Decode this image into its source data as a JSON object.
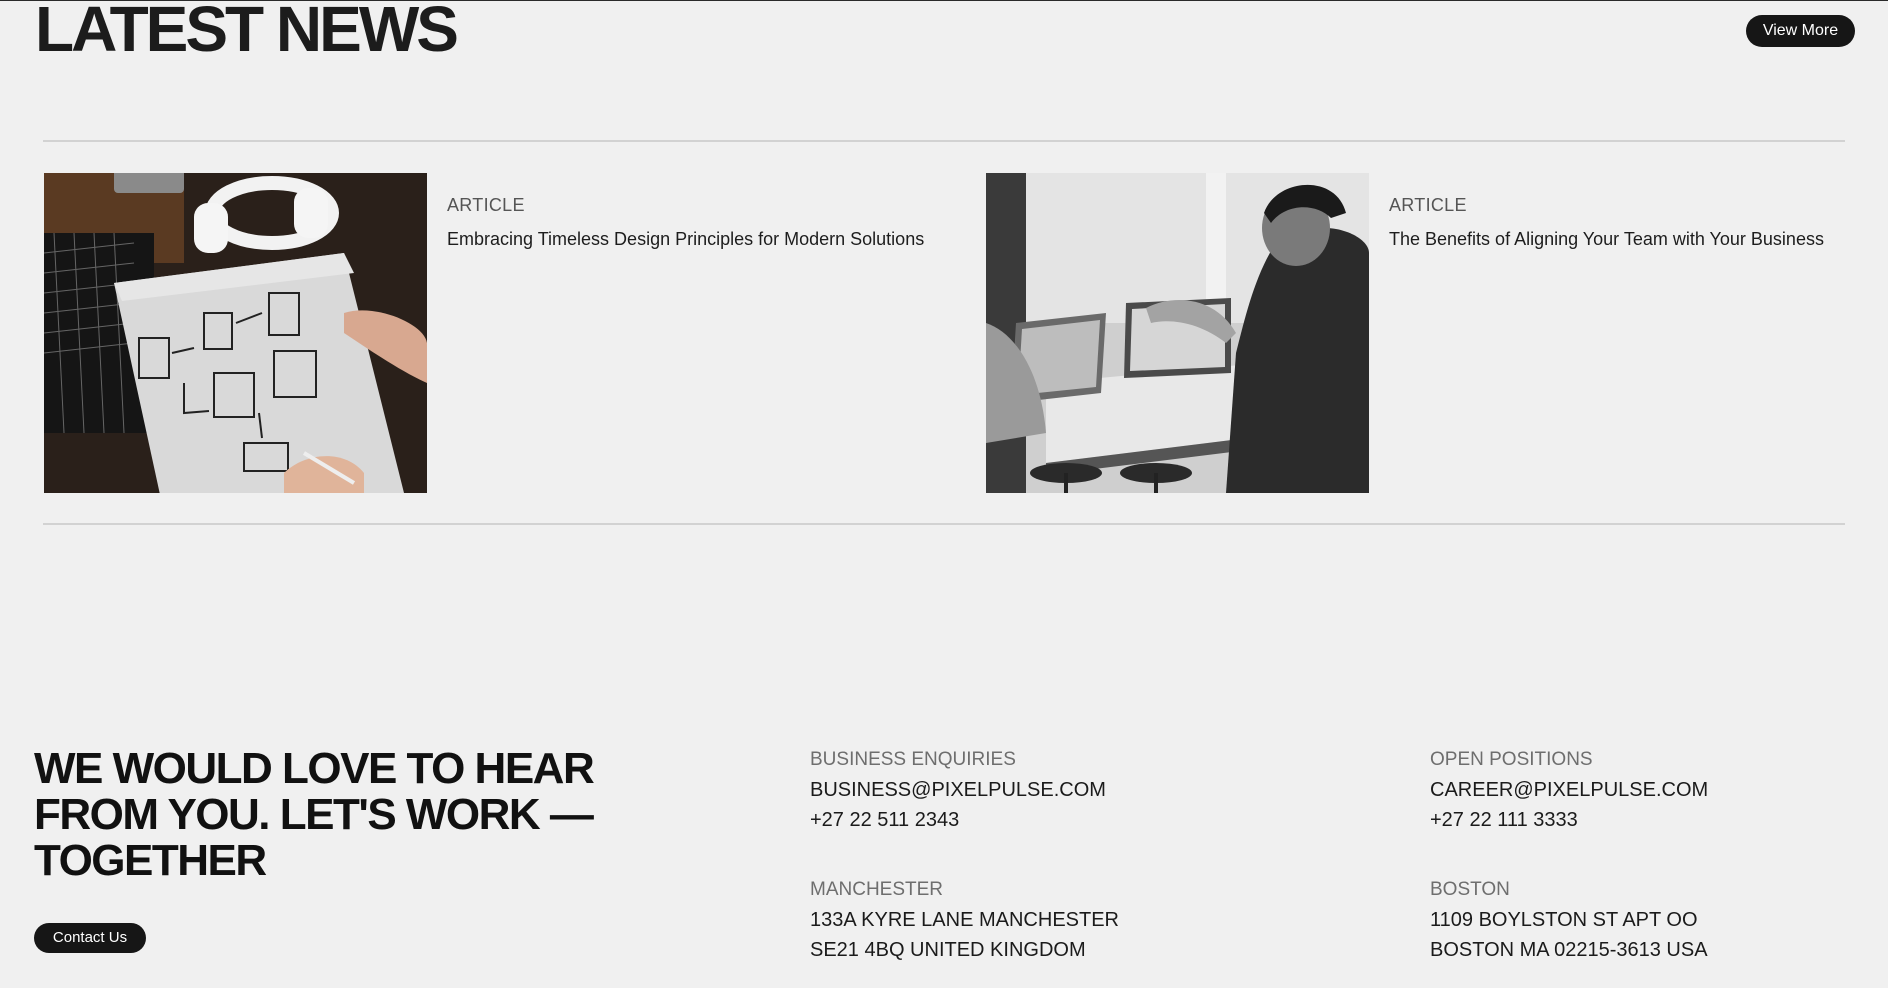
{
  "news": {
    "title": "LATEST NEWS",
    "view_more_label": "View More",
    "articles": [
      {
        "category": "ARTICLE",
        "headline": "Embracing Timeless Design Principles for Modern Solutions",
        "image_icon": "design-sketch-image"
      },
      {
        "category": "ARTICLE",
        "headline": "The Benefits of Aligning Your Team with Your Business",
        "image_icon": "team-meeting-image"
      }
    ]
  },
  "footer": {
    "heading": "WE WOULD LOVE TO HEAR FROM YOU. LET'S WORK — TOGETHER",
    "contact_label": "Contact Us",
    "business": {
      "label": "BUSINESS ENQUIRIES",
      "email": "BUSINESS@PIXELPULSE.COM",
      "phone": "+27 22 511 2343"
    },
    "careers": {
      "label": "OPEN POSITIONS",
      "email": "CAREER@PIXELPULSE.COM",
      "phone": "+27 22 111 3333"
    },
    "manchester": {
      "label": "MANCHESTER",
      "line1": "133A KYRE LANE MANCHESTER",
      "line2": "SE21 4BQ UNITED KINGDOM"
    },
    "boston": {
      "label": "BOSTON",
      "line1": "1109 BOYLSTON ST APT OO",
      "line2": "BOSTON MA 02215-3613 USA"
    }
  },
  "colors": {
    "background": "#f0f0f0",
    "button_bg": "#161616",
    "button_text": "#ffffff",
    "divider": "#d2d2d2",
    "muted_text": "#6e6e6e"
  }
}
